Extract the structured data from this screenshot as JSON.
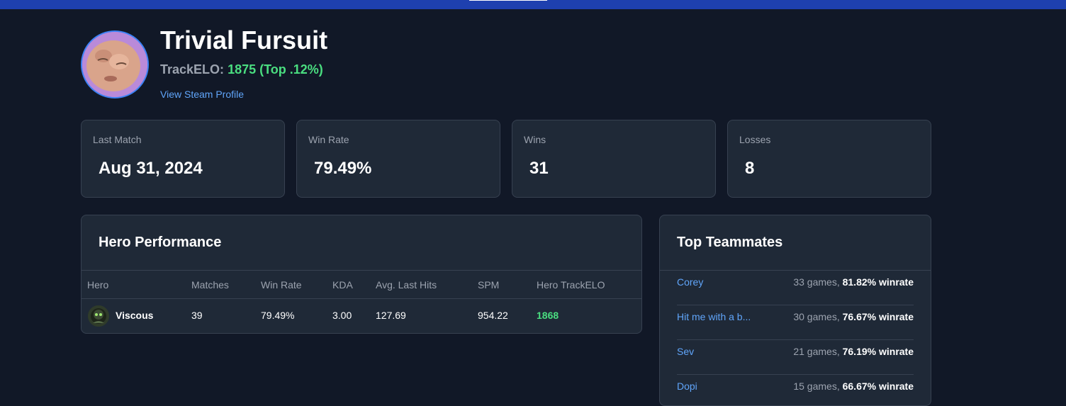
{
  "profile": {
    "name": "Trivial Fursuit",
    "elo_label": "TrackELO:",
    "elo_value": "1875 (Top .12%)",
    "steam_link": "View Steam Profile"
  },
  "stats": [
    {
      "label": "Last Match",
      "value": "Aug 31, 2024"
    },
    {
      "label": "Win Rate",
      "value": "79.49%"
    },
    {
      "label": "Wins",
      "value": "31"
    },
    {
      "label": "Losses",
      "value": "8"
    }
  ],
  "hero_performance": {
    "title": "Hero Performance",
    "columns": [
      "Hero",
      "Matches",
      "Win Rate",
      "KDA",
      "Avg. Last Hits",
      "SPM",
      "Hero TrackELO"
    ],
    "rows": [
      {
        "hero": "Viscous",
        "icon": "viscous-hero-icon",
        "matches": "39",
        "win_rate": "79.49%",
        "kda": "3.00",
        "avg_last_hits": "127.69",
        "spm": "954.22",
        "hero_elo": "1868"
      }
    ]
  },
  "top_teammates": {
    "title": "Top Teammates",
    "items": [
      {
        "name": "Corey",
        "games": "33 games,",
        "winrate": "81.82% winrate"
      },
      {
        "name": "Hit me with a b...",
        "games": "30 games,",
        "winrate": "76.67% winrate"
      },
      {
        "name": "Sev",
        "games": "21 games,",
        "winrate": "76.19% winrate"
      },
      {
        "name": "Dopi",
        "games": "15 games,",
        "winrate": "66.67% winrate"
      }
    ]
  },
  "colors": {
    "background": "#111827",
    "card": "#1f2937",
    "accent_blue": "#60a5fa",
    "elo_green": "#4ade80",
    "topbar": "#1e40af"
  }
}
